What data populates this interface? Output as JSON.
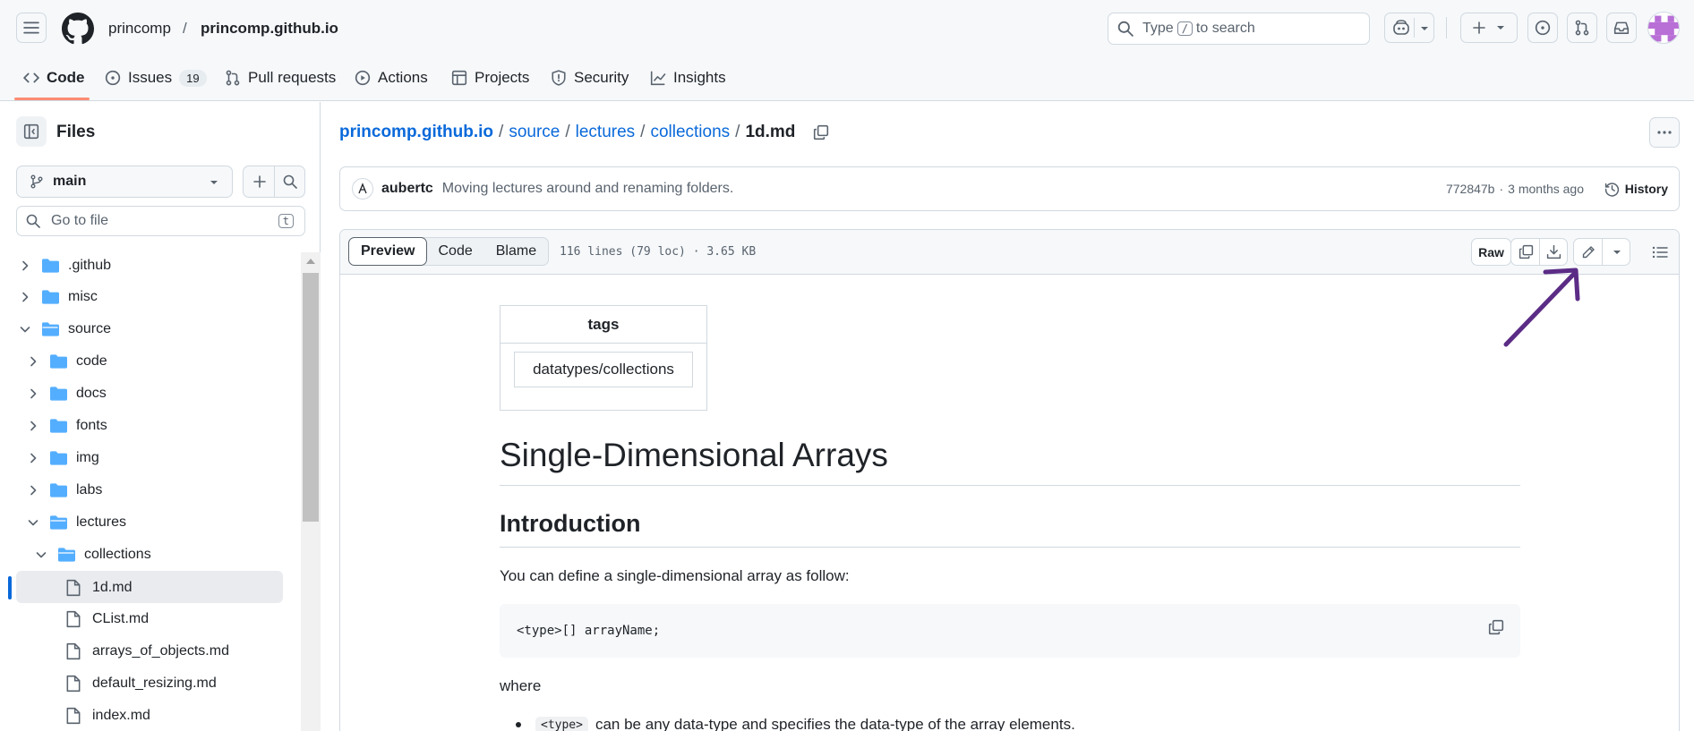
{
  "header": {
    "owner": "princomp",
    "slash": "/",
    "repo": "princomp.github.io",
    "search": {
      "prefix": "Type",
      "key": "/",
      "suffix": "to search"
    }
  },
  "nav": {
    "tabs": [
      {
        "label": "Code",
        "icon": "code-icon"
      },
      {
        "label": "Issues",
        "icon": "issue-opened-icon",
        "count": "19"
      },
      {
        "label": "Pull requests",
        "icon": "git-pull-request-icon"
      },
      {
        "label": "Actions",
        "icon": "play-icon"
      },
      {
        "label": "Projects",
        "icon": "table-icon"
      },
      {
        "label": "Security",
        "icon": "shield-icon"
      },
      {
        "label": "Insights",
        "icon": "graph-icon"
      }
    ]
  },
  "sidebar": {
    "title": "Files",
    "branch": "main",
    "goto_placeholder": "Go to file",
    "goto_key": "t",
    "tree": [
      {
        "label": ".github",
        "type": "folder",
        "state": "closed"
      },
      {
        "label": "misc",
        "type": "folder",
        "state": "closed"
      },
      {
        "label": "source",
        "type": "folder",
        "state": "open"
      },
      {
        "label": "code",
        "type": "folder",
        "state": "closed"
      },
      {
        "label": "docs",
        "type": "folder",
        "state": "closed"
      },
      {
        "label": "fonts",
        "type": "folder",
        "state": "closed"
      },
      {
        "label": "img",
        "type": "folder",
        "state": "closed"
      },
      {
        "label": "labs",
        "type": "folder",
        "state": "closed"
      },
      {
        "label": "lectures",
        "type": "folder",
        "state": "open"
      },
      {
        "label": "collections",
        "type": "folder",
        "state": "open"
      },
      {
        "label": "1d.md",
        "type": "file",
        "state": "selected"
      },
      {
        "label": "CList.md",
        "type": "file"
      },
      {
        "label": "arrays_of_objects.md",
        "type": "file"
      },
      {
        "label": "default_resizing.md",
        "type": "file"
      },
      {
        "label": "index.md",
        "type": "file"
      }
    ]
  },
  "breadcrumb": {
    "parts": [
      "princomp.github.io",
      "source",
      "lectures",
      "collections"
    ],
    "current": "1d.md",
    "sep": "/"
  },
  "commit": {
    "author": "aubertc",
    "message": "Moving lectures around and renaming folders.",
    "sha": "772847b",
    "dot": "·",
    "age": "3 months ago",
    "history_label": "History"
  },
  "file": {
    "views": [
      "Preview",
      "Code",
      "Blame"
    ],
    "active_view": "Preview",
    "meta": "116 lines (79 loc) · 3.65 KB",
    "raw_label": "Raw"
  },
  "content": {
    "tags_header": "tags",
    "tags_value": "datatypes/collections",
    "h1": "Single-Dimensional Arrays",
    "h2": "Introduction",
    "p1": "You can define a single-dimensional array as follow:",
    "code": "<type>[] arrayName;",
    "where": "where",
    "bullet_code": "<type>",
    "bullet_text": "can be any data-type and specifies the data-type of the array elements."
  },
  "colors": {
    "accent": "#0969da",
    "folder": "#54aeff",
    "annotation_arrow": "#5b2c86",
    "tab_underline": "#fd8c73"
  }
}
